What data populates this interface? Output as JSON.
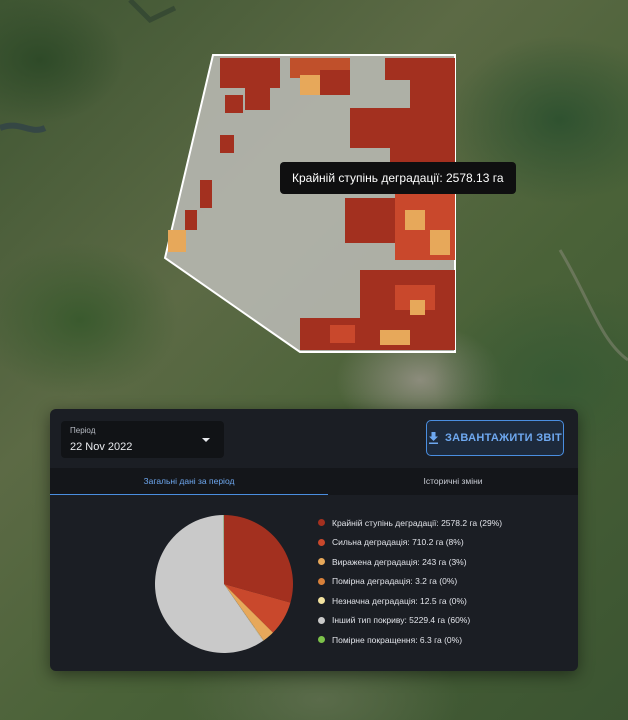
{
  "map": {
    "tooltip": "Крайній ступінь деградації: 2578.13 га"
  },
  "panel": {
    "period": {
      "label": "Період",
      "value": "22 Nov 2022"
    },
    "download_button": {
      "label": "ЗАВАНТАЖИТИ ЗВІТ",
      "icon": "download-icon"
    },
    "tabs": [
      {
        "label": "Загальні дані за період",
        "active": true
      },
      {
        "label": "Історичні зміни",
        "active": false
      }
    ]
  },
  "chart_data": {
    "type": "pie",
    "slices": [
      {
        "label": "Крайній ступінь деградації: 2578.2 га (29%)",
        "value": 2578.2,
        "percent": 29,
        "color": "#a3301f"
      },
      {
        "label": "Сильна деградація: 710.2 га (8%)",
        "value": 710.2,
        "percent": 8,
        "color": "#c9482c"
      },
      {
        "label": "Виражена деградація: 243 га (3%)",
        "value": 243,
        "percent": 3,
        "color": "#e7a85a"
      },
      {
        "label": "Помірна деградація: 3.2 га (0%)",
        "value": 3.2,
        "percent": 0,
        "color": "#d8803a"
      },
      {
        "label": "Незначна деградація: 12.5 га (0%)",
        "value": 12.5,
        "percent": 0,
        "color": "#f2e2a0"
      },
      {
        "label": "Інший тип покриву: 5229.4 га (60%)",
        "value": 5229.4,
        "percent": 60,
        "color": "#c9c9c9"
      },
      {
        "label": "Помірне покращення: 6.3 га (0%)",
        "value": 6.3,
        "percent": 0,
        "color": "#7cc24a"
      }
    ]
  }
}
